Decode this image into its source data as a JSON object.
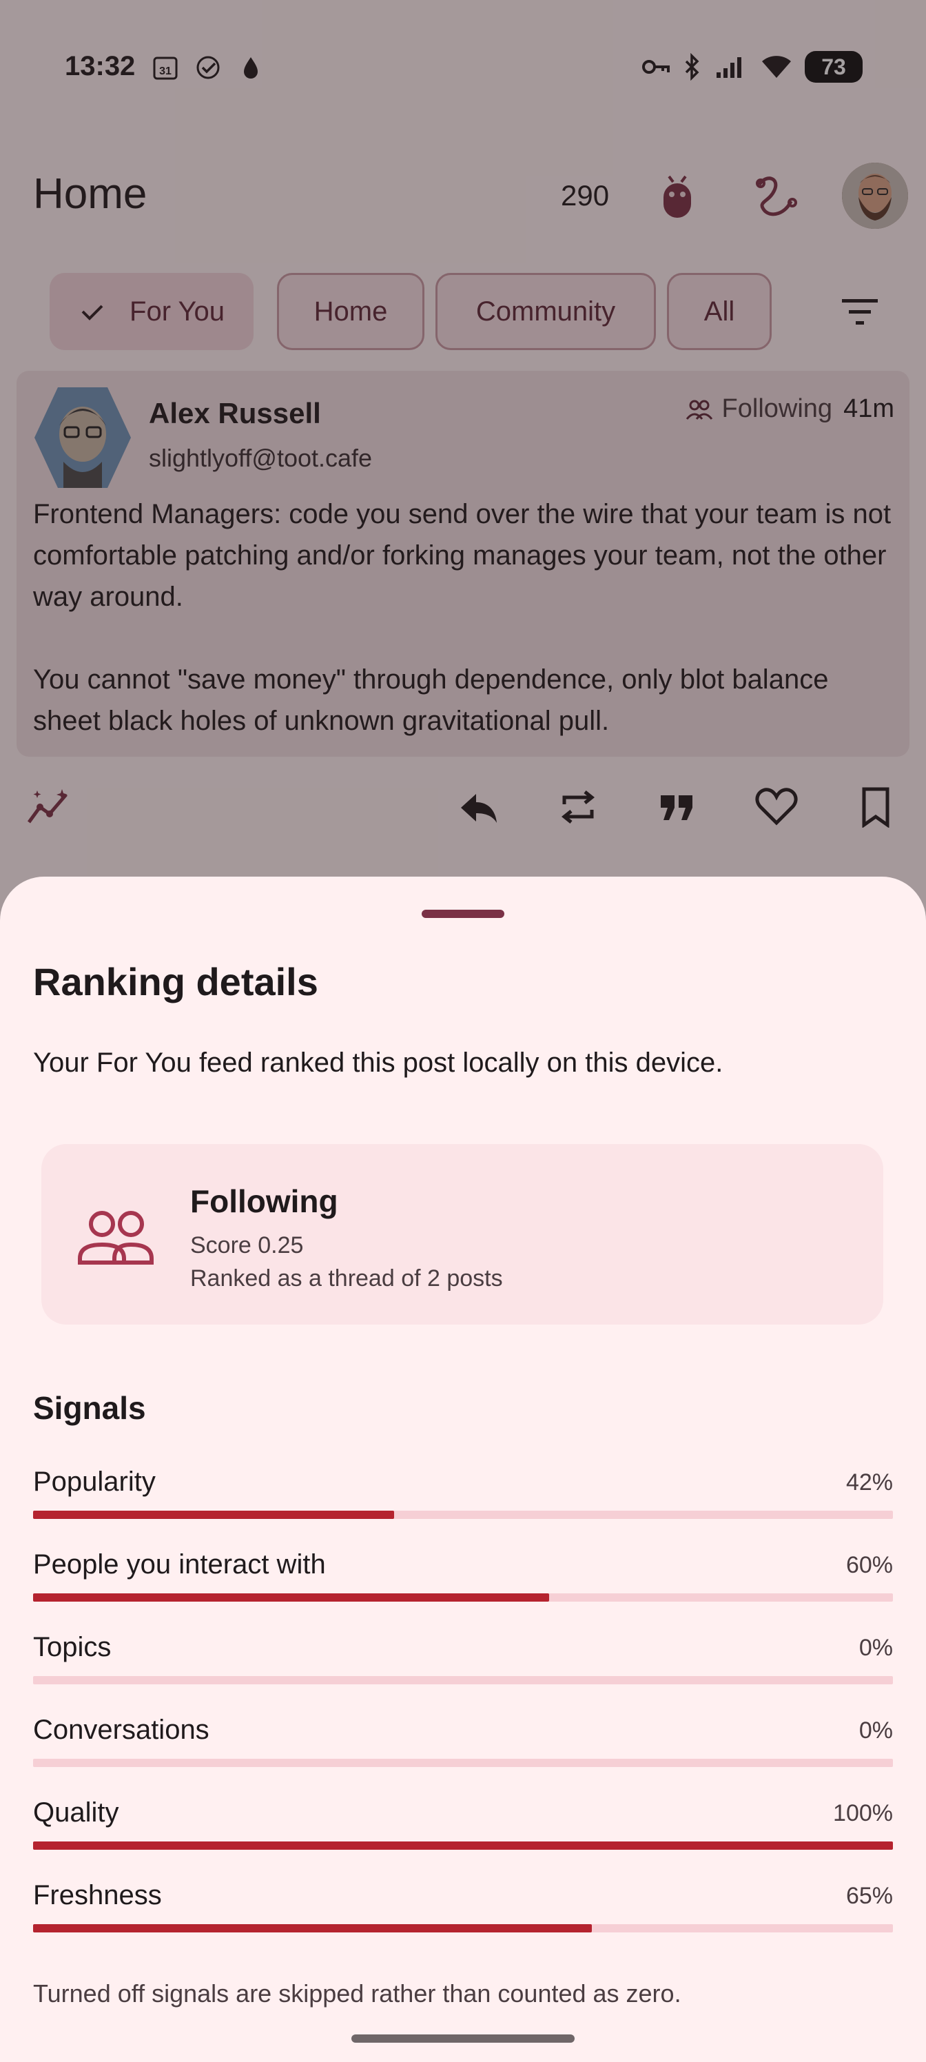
{
  "status_bar": {
    "time": "13:32",
    "calendar_day": "31",
    "battery": "73"
  },
  "app_bar": {
    "title": "Home",
    "notification_count": "290"
  },
  "tabs": [
    {
      "label": "For You",
      "selected": true
    },
    {
      "label": "Home",
      "selected": false
    },
    {
      "label": "Community",
      "selected": false
    },
    {
      "label": "All",
      "selected": false
    }
  ],
  "post": {
    "author": "Alex Russell",
    "handle": "slightlyoff@toot.cafe",
    "relation": "Following",
    "time": "41m",
    "paragraphs": [
      "Frontend Managers: code you send over the wire that your team is not comfortable patching and/or forking manages your team, not the other way around.",
      "You cannot \"save money\" through dependence, only blot balance sheet black holes of unknown gravitational pull."
    ]
  },
  "actions": [
    "explain-ranking-icon",
    "reply-icon",
    "boost-icon",
    "quote-icon",
    "favourite-icon",
    "bookmark-icon"
  ],
  "sheet": {
    "title": "Ranking details",
    "subtitle": "Your For You feed ranked this post locally on this device.",
    "ranking": {
      "label": "Following",
      "score": "Score 0.25",
      "note": "Ranked as a thread of 2 posts"
    },
    "signals_heading": "Signals",
    "signals": [
      {
        "label": "Popularity",
        "value": "42%",
        "fraction": 0.42
      },
      {
        "label": "People you interact with",
        "value": "60%",
        "fraction": 0.6
      },
      {
        "label": "Topics",
        "value": "0%",
        "fraction": 0
      },
      {
        "label": "Conversations",
        "value": "0%",
        "fraction": 0
      },
      {
        "label": "Quality",
        "value": "100%",
        "fraction": 1.0
      },
      {
        "label": "Freshness",
        "value": "65%",
        "fraction": 0.65
      }
    ],
    "footer_note": "Turned off signals are skipped rather than counted as zero."
  },
  "colors": {
    "accent": "#b5232f",
    "track": "#f6cfd5",
    "sheet_bg": "#fff0f1",
    "brand_icon": "#7a3146"
  }
}
